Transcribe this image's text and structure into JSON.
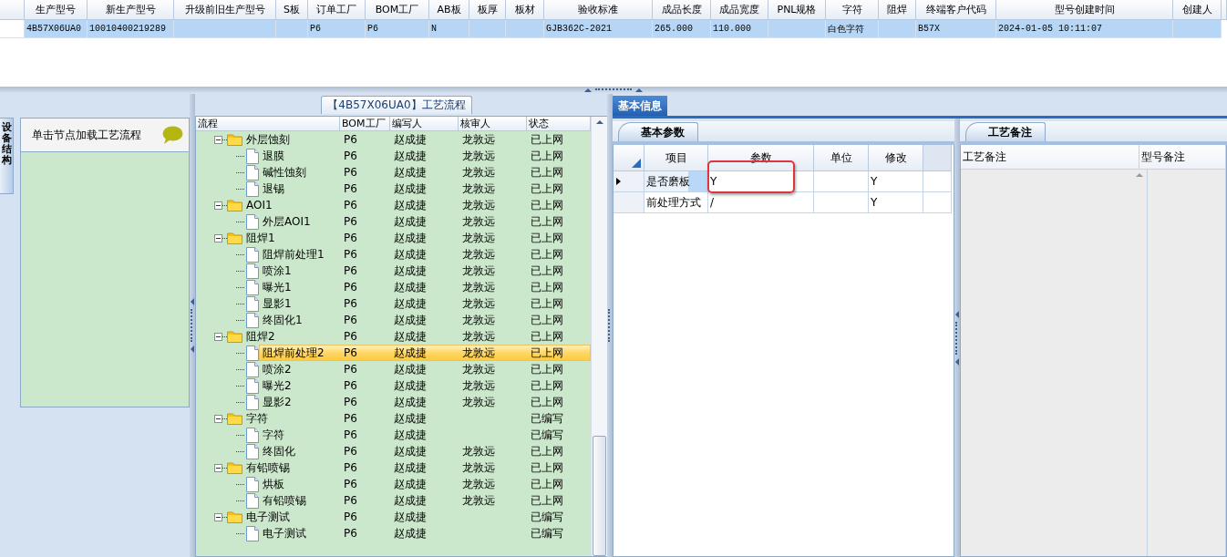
{
  "top_grid": {
    "columns": [
      "生产型号",
      "新生产型号",
      "升级前旧生产型号",
      "S板",
      "订单工厂",
      "BOM工厂",
      "AB板",
      "板厚",
      "板材",
      "验收标准",
      "成品长度",
      "成品宽度",
      "PNL规格",
      "字符",
      "阻焊",
      "终端客户代码",
      "型号创建时间",
      "创建人"
    ],
    "rows": [
      {
        "selected": true,
        "cells": [
          "4B57X06UA0",
          "10010400219289",
          null,
          null,
          "P6",
          "P6",
          "N",
          null,
          null,
          "GJB362C-2021",
          "265.000",
          "110.000",
          null,
          "白色字符",
          null,
          "B57X",
          "2024-01-05 10:11:07",
          null
        ]
      }
    ]
  },
  "left_panel": {
    "vertical_tab": "设备结构",
    "hint": "单击节点加载工艺流程"
  },
  "process_panel": {
    "title": "【4B57X06UA0】工艺流程",
    "columns": [
      "流程",
      "BOM工厂",
      "编写人",
      "核审人",
      "状态"
    ],
    "tree": [
      {
        "name": "外层蚀刻",
        "bom": "P6",
        "writer": "赵成捷",
        "reviewer": "龙敦远",
        "status": "已上网",
        "selected": false,
        "expanded": true,
        "children": [
          {
            "name": "退膜",
            "bom": "P6",
            "writer": "赵成捷",
            "reviewer": "龙敦远",
            "status": "已上网",
            "selected": false
          },
          {
            "name": "碱性蚀刻",
            "bom": "P6",
            "writer": "赵成捷",
            "reviewer": "龙敦远",
            "status": "已上网",
            "selected": false
          },
          {
            "name": "退锡",
            "bom": "P6",
            "writer": "赵成捷",
            "reviewer": "龙敦远",
            "status": "已上网",
            "selected": false
          }
        ]
      },
      {
        "name": "AOI1",
        "bom": "P6",
        "writer": "赵成捷",
        "reviewer": "龙敦远",
        "status": "已上网",
        "selected": false,
        "expanded": true,
        "children": [
          {
            "name": "外层AOI1",
            "bom": "P6",
            "writer": "赵成捷",
            "reviewer": "龙敦远",
            "status": "已上网",
            "selected": false
          }
        ]
      },
      {
        "name": "阻焊1",
        "bom": "P6",
        "writer": "赵成捷",
        "reviewer": "龙敦远",
        "status": "已上网",
        "selected": false,
        "expanded": true,
        "children": [
          {
            "name": "阻焊前处理1",
            "bom": "P6",
            "writer": "赵成捷",
            "reviewer": "龙敦远",
            "status": "已上网",
            "selected": false
          },
          {
            "name": "喷涂1",
            "bom": "P6",
            "writer": "赵成捷",
            "reviewer": "龙敦远",
            "status": "已上网",
            "selected": false
          },
          {
            "name": "曝光1",
            "bom": "P6",
            "writer": "赵成捷",
            "reviewer": "龙敦远",
            "status": "已上网",
            "selected": false
          },
          {
            "name": "显影1",
            "bom": "P6",
            "writer": "赵成捷",
            "reviewer": "龙敦远",
            "status": "已上网",
            "selected": false
          },
          {
            "name": "终固化1",
            "bom": "P6",
            "writer": "赵成捷",
            "reviewer": "龙敦远",
            "status": "已上网",
            "selected": false
          }
        ]
      },
      {
        "name": "阻焊2",
        "bom": "P6",
        "writer": "赵成捷",
        "reviewer": "龙敦远",
        "status": "已上网",
        "selected": false,
        "expanded": true,
        "children": [
          {
            "name": "阻焊前处理2",
            "bom": "P6",
            "writer": "赵成捷",
            "reviewer": "龙敦远",
            "status": "已上网",
            "selected": true
          },
          {
            "name": "喷涂2",
            "bom": "P6",
            "writer": "赵成捷",
            "reviewer": "龙敦远",
            "status": "已上网",
            "selected": false
          },
          {
            "name": "曝光2",
            "bom": "P6",
            "writer": "赵成捷",
            "reviewer": "龙敦远",
            "status": "已上网",
            "selected": false
          },
          {
            "name": "显影2",
            "bom": "P6",
            "writer": "赵成捷",
            "reviewer": "龙敦远",
            "status": "已上网",
            "selected": false
          }
        ]
      },
      {
        "name": "字符",
        "bom": "P6",
        "writer": "赵成捷",
        "status": "已编写",
        "selected": false,
        "expanded": true,
        "children": [
          {
            "name": "字符",
            "bom": "P6",
            "writer": "赵成捷",
            "status": "已编写",
            "selected": false
          },
          {
            "name": "终固化",
            "bom": "P6",
            "writer": "赵成捷",
            "reviewer": "龙敦远",
            "status": "已上网",
            "selected": false
          }
        ]
      },
      {
        "name": "有铅喷锡",
        "bom": "P6",
        "writer": "赵成捷",
        "reviewer": "龙敦远",
        "status": "已上网",
        "selected": false,
        "expanded": true,
        "children": [
          {
            "name": "烘板",
            "bom": "P6",
            "writer": "赵成捷",
            "reviewer": "龙敦远",
            "status": "已上网",
            "selected": false
          },
          {
            "name": "有铅喷锡",
            "bom": "P6",
            "writer": "赵成捷",
            "reviewer": "龙敦远",
            "status": "已上网",
            "selected": false
          }
        ]
      },
      {
        "name": "电子测试",
        "bom": "P6",
        "writer": "赵成捷",
        "status": "已编写",
        "selected": false,
        "expanded": true,
        "children": [
          {
            "name": "电子测试",
            "bom": "P6",
            "writer": "赵成捷",
            "status": "已编写",
            "selected": false
          }
        ]
      }
    ]
  },
  "info_tabs": [
    {
      "label": "基本信息",
      "selected": true
    }
  ],
  "params_panel": {
    "tab": "基本参数",
    "columns": [
      "项目",
      "参数",
      "单位",
      "修改"
    ],
    "rows": [
      {
        "current": true,
        "cells": [
          "是否磨板",
          "Y",
          null,
          "Y"
        ]
      },
      {
        "current": false,
        "cells": [
          "前处理方式",
          "/",
          null,
          "Y"
        ]
      }
    ]
  },
  "notes_panel": {
    "tab": "工艺备注",
    "columns": [
      "工艺备注",
      "型号备注"
    ]
  }
}
